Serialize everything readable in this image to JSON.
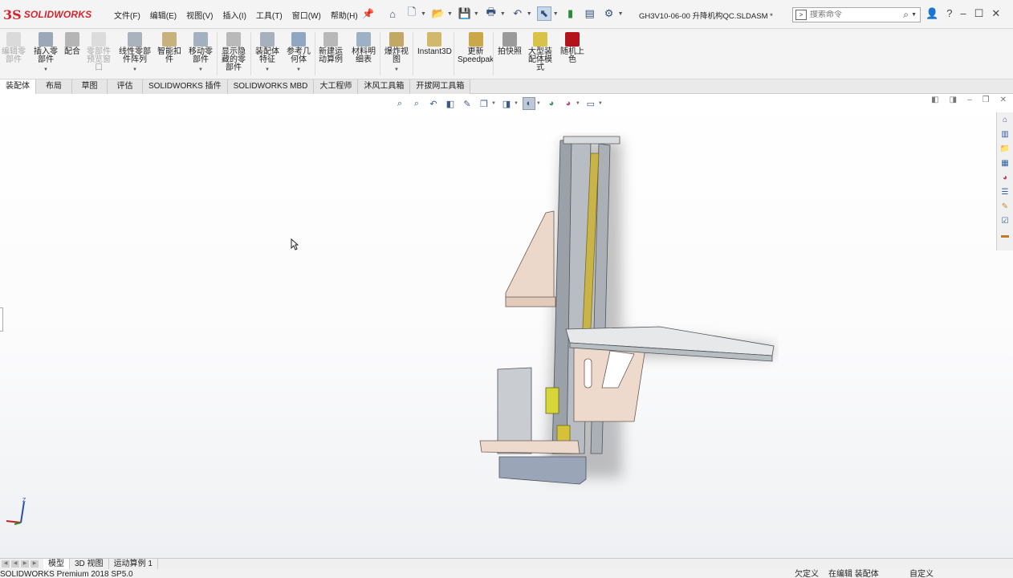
{
  "app": {
    "logo_mark": "3S",
    "logo_text": "SOLIDWORKS",
    "document_title": "GH3V10-06-00 升降机构QC.SLDASM *"
  },
  "menu": [
    "文件(F)",
    "编辑(E)",
    "视图(V)",
    "插入(I)",
    "工具(T)",
    "窗口(W)",
    "帮助(H)"
  ],
  "search": {
    "placeholder": "搜索命令"
  },
  "ribbon": {
    "edit_part": "编辑零\n部件",
    "insert_part": "插入零\n部件",
    "mate": "配合",
    "component_preview": "零部件\n预览窗\n口",
    "linear_pattern": "线性零部\n件阵列",
    "smart_fasteners": "智能扣\n件",
    "move_component": "移动零\n部件",
    "show_hidden": "显示隐\n藏的零\n部件",
    "assembly_features": "装配体\n特征",
    "reference_geometry": "参考几\n何体",
    "new_motion_study": "新建运\n动算例",
    "bill_of_materials": "材料明\n细表",
    "exploded_view": "爆炸视\n图",
    "instant3d": "Instant3D",
    "update_speedpak": "更新\nSpeedpak",
    "snapshot": "拍快照",
    "large_assembly_mode": "大型装\n配体模\n式",
    "random_color": "随机上\n色"
  },
  "tabs": [
    "装配体",
    "布局",
    "草图",
    "评估",
    "SOLIDWORKS 插件",
    "SOLIDWORKS MBD",
    "大工程师",
    "沐风工具箱",
    "开拔网工具箱"
  ],
  "active_tab": "装配体",
  "bottom_tabs": [
    "模型",
    "3D 视图",
    "运动算例 1"
  ],
  "status": {
    "product": "SOLIDWORKS Premium 2018 SP5.0",
    "defined": "欠定义",
    "editing": "在编辑 装配体",
    "custom": "自定义"
  },
  "colors": {
    "accent": "#d6242c",
    "ribbon_bg": "#f4f4f4",
    "model_plate": "#e9d3c4",
    "model_rail": "#9aa1a8",
    "model_screw": "#c9b44a"
  },
  "icons": [
    "home-icon",
    "new-doc-icon",
    "open-icon",
    "save-icon",
    "print-icon",
    "undo-icon",
    "select-icon",
    "traffic-light-icon",
    "options-icon",
    "user-icon",
    "help-icon"
  ]
}
